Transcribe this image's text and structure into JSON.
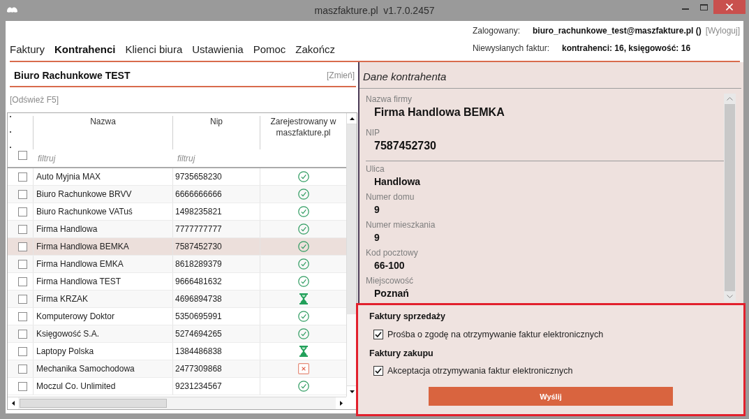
{
  "window": {
    "title": "maszfakture.pl  v1.7.0.2457"
  },
  "menu": [
    {
      "label": "Faktury",
      "selected": false
    },
    {
      "label": "Kontrahenci",
      "selected": true
    },
    {
      "label": "Klienci biura",
      "selected": false
    },
    {
      "label": "Ustawienia",
      "selected": false
    },
    {
      "label": "Pomoc",
      "selected": false
    },
    {
      "label": "Zakończ",
      "selected": false
    }
  ],
  "account": {
    "logged_in_label": "Zalogowany:",
    "user": "biuro_rachunkowe_test@maszfakture.pl ()",
    "logout_link": "[Wyloguj]",
    "unsent_label": "Niewysłanych faktur:",
    "unsent_counts": "kontrahenci: 16, księgowość: 16"
  },
  "contractors": {
    "title": "Biuro Rachunkowe TEST",
    "change_link": "[Zmień]",
    "refresh_link": "[Odśwież F5]",
    "table": {
      "columns": [
        "Nazwa",
        "Nip",
        "Zarejestrowany w maszfakture.pl"
      ],
      "select_all_checked": false,
      "filters": [
        {
          "placeholder": "filtruj"
        },
        {
          "placeholder": "filtruj"
        }
      ],
      "rows": [
        {
          "name": "Auto Myjnia MAX",
          "nip": "9735658230",
          "kind": "registered",
          "checked": false,
          "selected": false
        },
        {
          "name": "Biuro Rachunkowe BRVV",
          "nip": "6666666666",
          "kind": "registered",
          "checked": false,
          "selected": false
        },
        {
          "name": "Biuro Rachunkowe VATuś",
          "nip": "1498235821",
          "kind": "registered",
          "checked": false,
          "selected": false
        },
        {
          "name": "Firma Handlowa",
          "nip": "7777777777",
          "kind": "registered",
          "checked": false,
          "selected": false
        },
        {
          "name": "Firma Handlowa BEMKA",
          "nip": "7587452730",
          "kind": "registered",
          "checked": false,
          "selected": true
        },
        {
          "name": "Firma Handlowa EMKA",
          "nip": "8618289379",
          "kind": "registered",
          "checked": false,
          "selected": false
        },
        {
          "name": "Firma Handlowa TEST",
          "nip": "9666481632",
          "kind": "registered",
          "checked": false,
          "selected": false
        },
        {
          "name": "Firma KRZAK",
          "nip": "4696894738",
          "kind": "pending",
          "checked": false,
          "selected": false
        },
        {
          "name": "Komputerowy Doktor",
          "nip": "5350695991",
          "kind": "registered",
          "checked": false,
          "selected": false
        },
        {
          "name": "Księgowość S.A.",
          "nip": "5274694265",
          "kind": "registered",
          "checked": false,
          "selected": false
        },
        {
          "name": "Laptopy Polska",
          "nip": "1384486838",
          "kind": "pending",
          "checked": false,
          "selected": false
        },
        {
          "name": "Mechanika Samochodowa",
          "nip": "2477309868",
          "kind": "rejected",
          "checked": false,
          "selected": false
        },
        {
          "name": "Moczul Co. Unlimited",
          "nip": "9231234567",
          "kind": "registered",
          "checked": false,
          "selected": false
        }
      ]
    }
  },
  "details": {
    "title": "Dane kontrahenta",
    "groups": [
      {
        "kind": "main",
        "fields": [
          {
            "label": "Nazwa firmy",
            "value": "Firma Handlowa BEMKA"
          },
          {
            "label": "NIP",
            "value": "7587452730"
          }
        ]
      },
      {
        "kind": "address",
        "fields": [
          {
            "label": "Ulica",
            "value": "Handlowa"
          },
          {
            "label": "Numer domu",
            "value": "9"
          },
          {
            "label": "Numer mieszkania",
            "value": "9"
          },
          {
            "label": "Kod pocztowy",
            "value": "66-100"
          },
          {
            "label": "Miejscowość",
            "value": "Poznań"
          }
        ]
      }
    ]
  },
  "consents": {
    "highlighted": true,
    "sections": [
      {
        "heading": "Faktury sprzedaży",
        "option": "Prośba o zgodę na otrzymywanie faktur elektronicznych",
        "checked": true
      },
      {
        "heading": "Faktury zakupu",
        "option": "Akceptacja otrzymywania faktur elektronicznych",
        "checked": true
      }
    ],
    "button": "Wyślij"
  }
}
